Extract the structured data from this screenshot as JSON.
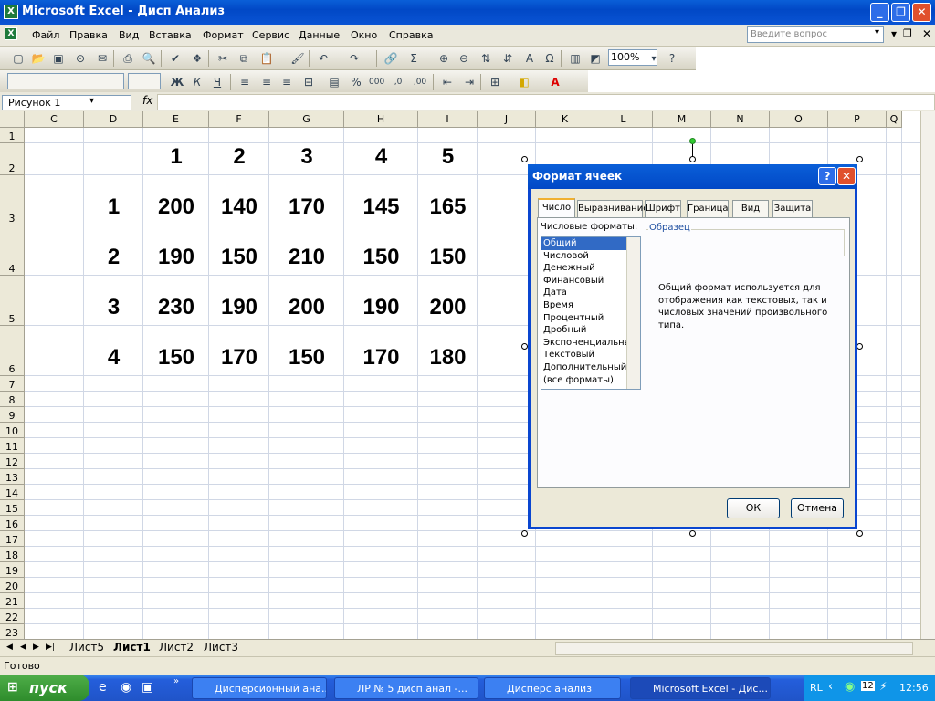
{
  "window": {
    "title": "Microsoft Excel - Дисп Анализ",
    "controls": [
      "_",
      "▫",
      "X"
    ]
  },
  "menu": {
    "items": [
      "Файл",
      "Правка",
      "Вид",
      "Вставка",
      "Формат",
      "Сервис",
      "Данные",
      "Окно",
      "Справка"
    ],
    "ask_placeholder": "Введите вопрос"
  },
  "toolbar": {
    "zoom": "100%"
  },
  "formula": {
    "namebox": "Рисунок 1",
    "fx": "fx"
  },
  "grid": {
    "columns": [
      "C",
      "D",
      "E",
      "F",
      "G",
      "H",
      "I",
      "J",
      "K",
      "L",
      "M",
      "N",
      "O",
      "P",
      "Q"
    ],
    "rows": [
      "1",
      "2",
      "3",
      "4",
      "5",
      "6",
      "7",
      "8",
      "9",
      "10",
      "11",
      "12",
      "13",
      "14",
      "15",
      "16",
      "17",
      "18",
      "19",
      "20",
      "21",
      "22",
      "23"
    ],
    "header_row": [
      "1",
      "2",
      "3",
      "4",
      "5"
    ],
    "row_labels": [
      "1",
      "2",
      "3",
      "4"
    ],
    "values": [
      [
        "200",
        "140",
        "170",
        "145",
        "165"
      ],
      [
        "190",
        "150",
        "210",
        "150",
        "150"
      ],
      [
        "230",
        "190",
        "200",
        "190",
        "200"
      ],
      [
        "150",
        "170",
        "150",
        "170",
        "180"
      ]
    ]
  },
  "dialog": {
    "title": "Формат ячеек",
    "tabs": [
      "Число",
      "Выравнивание",
      "Шрифт",
      "Граница",
      "Вид",
      "Защита"
    ],
    "formats_label": "Числовые форматы:",
    "formats": [
      "Общий",
      "Числовой",
      "Денежный",
      "Финансовый",
      "Дата",
      "Время",
      "Процентный",
      "Дробный",
      "Экспоненциальный",
      "Текстовый",
      "Дополнительный",
      "(все форматы)"
    ],
    "sample_label": "Образец",
    "description": "Общий формат используется для отображения как текстовых, так и числовых значений произвольного типа.",
    "ok": "ОК",
    "cancel": "Отмена"
  },
  "sheets": {
    "tabs": [
      "Лист5",
      "Лист1",
      "Лист2",
      "Лист3"
    ],
    "active": "Лист1"
  },
  "status": {
    "text": "Готово"
  },
  "taskbar": {
    "start": "пуск",
    "tasks": [
      "Дисперсионный ана...",
      "ЛР № 5 дисп анал -...",
      "Дисперс анализ",
      "Microsoft Excel - Дис..."
    ],
    "lang": "RL",
    "clock": "12:56",
    "tray_number": "12"
  }
}
